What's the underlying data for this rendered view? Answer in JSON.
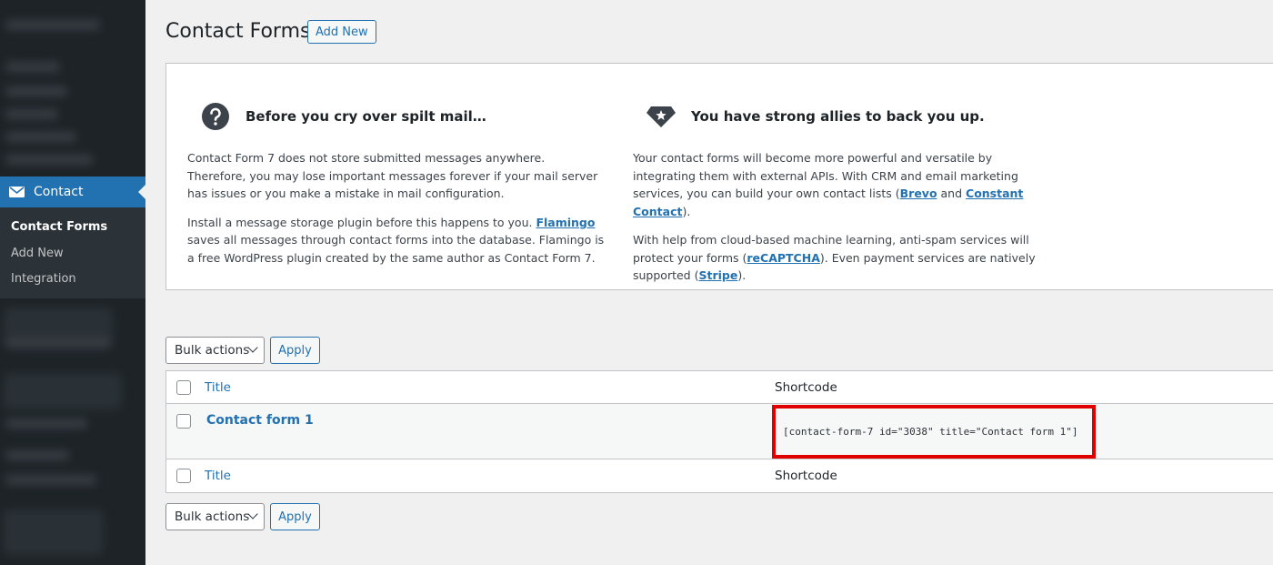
{
  "sidebar": {
    "menu_item": "Contact",
    "submenu": [
      "Contact Forms",
      "Add New",
      "Integration"
    ],
    "current_submenu": "Contact Forms"
  },
  "header": {
    "title": "Contact Forms",
    "add_new": "Add New"
  },
  "welcome": {
    "col1": {
      "title": "Before you cry over spilt mail…",
      "p1": "Contact Form 7 does not store submitted messages anywhere. Therefore, you may lose important messages forever if your mail server has issues or you make a mistake in mail configuration.",
      "p2_before": "Install a message storage plugin before this happens to you. ",
      "p2_link": "Flamingo",
      "p2_after": " saves all messages through contact forms into the database. Flamingo is a free WordPress plugin created by the same author as Contact Form 7."
    },
    "col2": {
      "title": "You have strong allies to back you up.",
      "p1_before": "Your contact forms will become more powerful and versatile by integrating them with external APIs. With CRM and email marketing services, you can build your own contact lists (",
      "p1_link1": "Brevo",
      "p1_mid": " and ",
      "p1_link2": "Constant Contact",
      "p1_after": ").",
      "p2_before": "With help from cloud-based machine learning, anti-spam services will protect your forms (",
      "p2_link1": "reCAPTCHA",
      "p2_mid": "). Even payment services are natively supported (",
      "p2_link2": "Stripe",
      "p2_after": ")."
    }
  },
  "bulk": {
    "select_label": "Bulk actions",
    "apply_label": "Apply"
  },
  "table": {
    "columns": [
      "Title",
      "Shortcode"
    ],
    "rows": [
      {
        "title": "Contact form 1",
        "shortcode": "[contact-form-7 id=\"3038\" title=\"Contact form 1\"]"
      }
    ]
  },
  "icons": {
    "menu": "mail-icon",
    "col1": "question-circle-icon",
    "col2": "shield-star-icon"
  },
  "colors": {
    "accent": "#2271b1",
    "sidebar": "#1d2327",
    "highlight_border": "#e00000"
  }
}
